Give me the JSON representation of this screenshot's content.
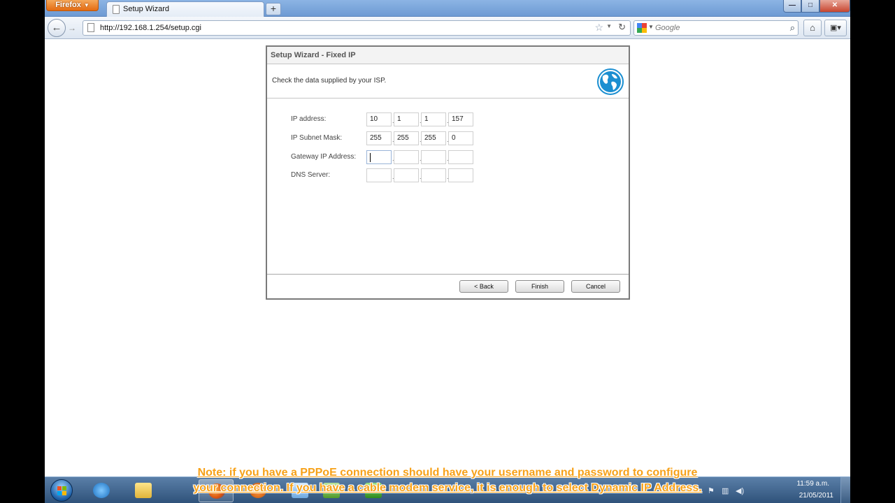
{
  "browser": {
    "menu_button": "Firefox",
    "tab_title": "Setup Wizard",
    "new_tab": "+",
    "url": "http://192.168.1.254/setup.cgi",
    "search_placeholder": "Google"
  },
  "wizard": {
    "title": "Setup Wizard - Fixed IP",
    "instruction": "Check the data supplied by your ISP.",
    "fields": [
      {
        "label": "IP address:",
        "octets": [
          "10",
          "1",
          "1",
          "157"
        ]
      },
      {
        "label": "IP Subnet Mask:",
        "octets": [
          "255",
          "255",
          "255",
          "0"
        ]
      },
      {
        "label": "Gateway IP Address:",
        "octets": [
          "",
          "",
          "",
          ""
        ]
      },
      {
        "label": "DNS Server:",
        "octets": [
          "",
          "",
          "",
          ""
        ]
      }
    ],
    "buttons": {
      "back": "< Back",
      "finish": "Finish",
      "cancel": "Cancel"
    }
  },
  "caption": {
    "line1": "Note: if you have a PPPoE connection should have your username and password to configure",
    "line2": "your connection. If you have a cable modem service, it is enough to select Dynamic IP Address."
  },
  "taskbar": {
    "time": "11:59 a.m.",
    "date": "21/05/2011"
  },
  "colors": {
    "caption": "#f7a118",
    "firefox_button": "#e46b11",
    "globe": "#1b8fd1"
  }
}
